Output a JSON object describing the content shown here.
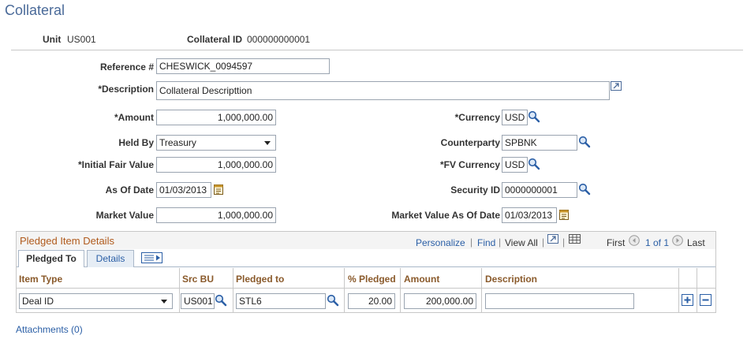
{
  "page": {
    "title": "Collateral"
  },
  "header": {
    "unit_label": "Unit",
    "unit_value": "US001",
    "collateral_id_label": "Collateral ID",
    "collateral_id_value": "000000000001"
  },
  "form": {
    "reference_label": "Reference #",
    "reference_value": "CHESWICK_0094597",
    "description_label": "*Description",
    "description_value": "Collateral Descripttion",
    "amount_label": "*Amount",
    "amount_value": "1,000,000.00",
    "currency_label": "*Currency",
    "currency_value": "USD",
    "held_by_label": "Held By",
    "held_by_value": "Treasury",
    "counterparty_label": "Counterparty",
    "counterparty_value": "SPBNK",
    "initial_fair_value_label": "*Initial Fair Value",
    "initial_fair_value_value": "1,000,000.00",
    "fv_currency_label": "*FV Currency",
    "fv_currency_value": "USD",
    "as_of_date_label": "As Of Date",
    "as_of_date_value": "01/03/2013",
    "security_id_label": "Security ID",
    "security_id_value": "0000000001",
    "market_value_label": "Market Value",
    "market_value_value": "1,000,000.00",
    "market_value_date_label": "Market Value As Of Date",
    "market_value_date_value": "01/03/2013"
  },
  "grid": {
    "title": "Pledged Item Details",
    "personalize": "Personalize",
    "find": "Find",
    "view_all": "View All",
    "first": "First",
    "range": "1 of 1",
    "last": "Last",
    "tabs": [
      "Pledged To",
      "Details"
    ],
    "columns": [
      "Item Type",
      "Src BU",
      "Pledged to",
      "% Pledged",
      "Amount",
      "Description"
    ],
    "row": {
      "item_type": "Deal ID",
      "src_bu": "US001",
      "pledged_to": "STL6",
      "pct_pledged": "20.00",
      "amount": "200,000.00",
      "description": ""
    }
  },
  "footer": {
    "attachments": "Attachments (0)"
  },
  "colors": {
    "title": "#4a6a99",
    "link": "#2b5fa6",
    "grid_title": "#b05a1c",
    "column_header": "#8a5a2b"
  }
}
